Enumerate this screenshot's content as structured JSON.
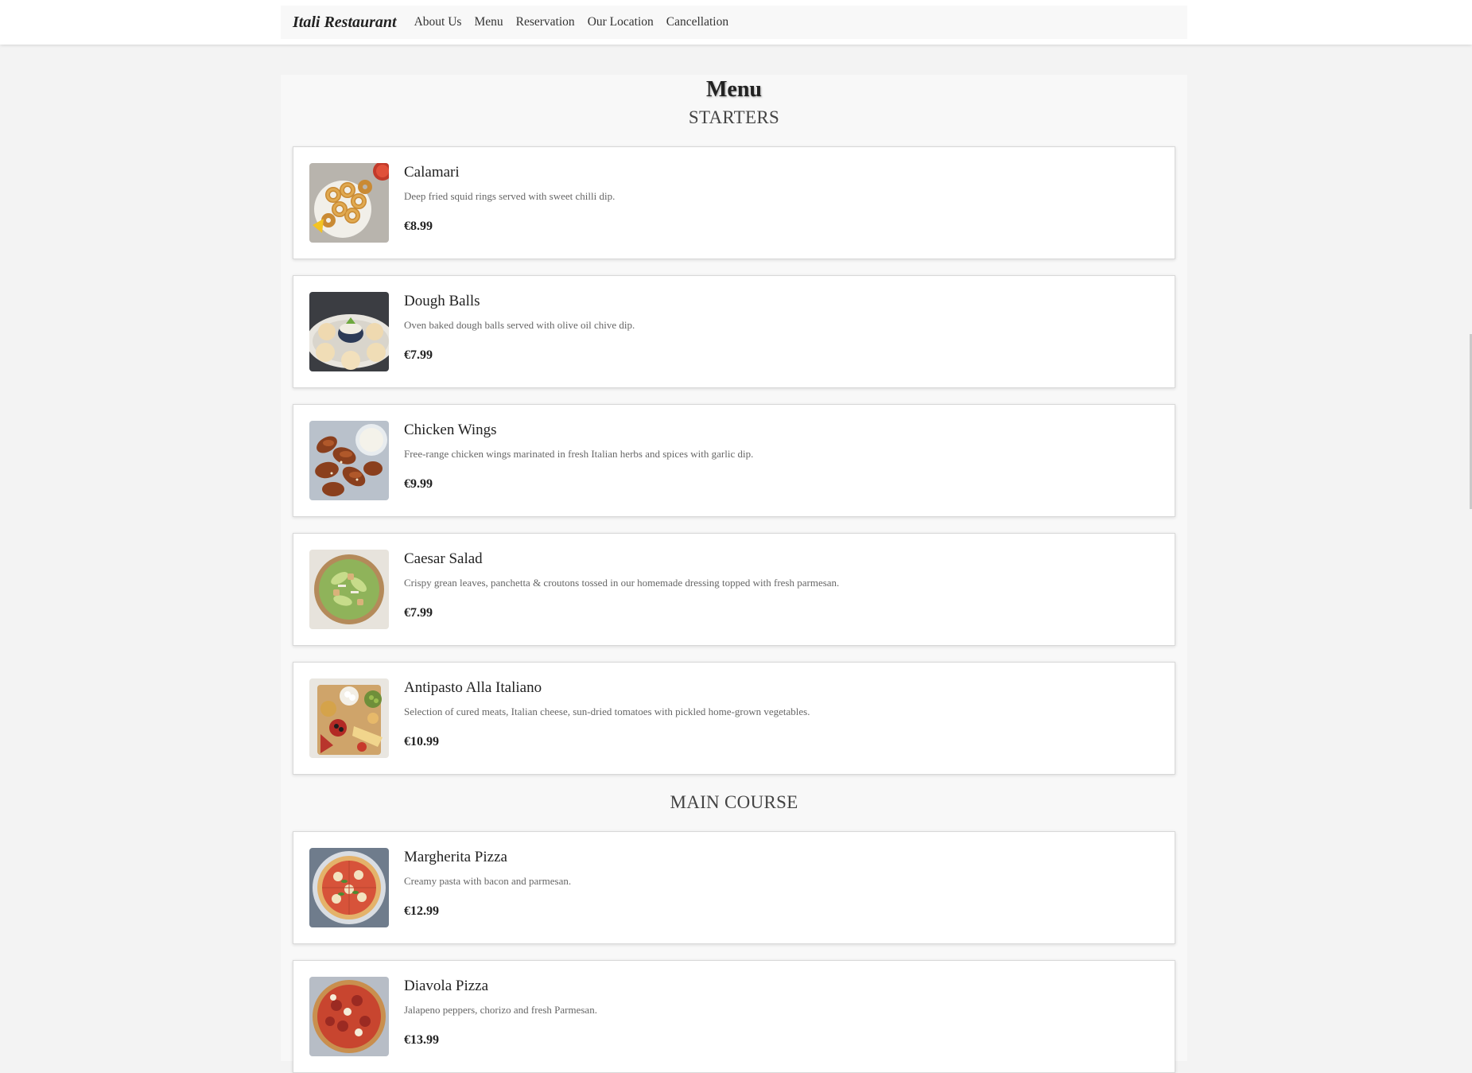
{
  "nav": {
    "brand": "Itali Restaurant",
    "links": [
      "About Us",
      "Menu",
      "Reservation",
      "Our Location",
      "Cancellation"
    ]
  },
  "page": {
    "title": "Menu"
  },
  "sections": [
    {
      "title": "STARTERS",
      "items": [
        {
          "name": "Calamari",
          "description": "Deep fried squid rings served with sweet chilli dip.",
          "price": "€8.99",
          "image": "calamari-photo"
        },
        {
          "name": "Dough Balls",
          "description": "Oven baked dough balls served with olive oil chive dip.",
          "price": "€7.99",
          "image": "dough-balls-photo"
        },
        {
          "name": "Chicken Wings",
          "description": "Free-range chicken wings marinated in fresh Italian herbs and spices with garlic dip.",
          "price": "€9.99",
          "image": "chicken-wings-photo"
        },
        {
          "name": "Caesar Salad",
          "description": "Crispy grean leaves, panchetta & croutons tossed in our homemade dressing topped with fresh parmesan.",
          "price": "€7.99",
          "image": "caesar-salad-photo"
        },
        {
          "name": "Antipasto Alla Italiano",
          "description": "Selection of cured meats, Italian cheese, sun-dried tomatoes with pickled home-grown vegetables.",
          "price": "€10.99",
          "image": "antipasto-photo"
        }
      ]
    },
    {
      "title": "MAIN COURSE",
      "items": [
        {
          "name": "Margherita Pizza",
          "description": "Creamy pasta with bacon and parmesan.",
          "price": "€12.99",
          "image": "margherita-pizza-photo"
        },
        {
          "name": "Diavola Pizza",
          "description": "Jalapeno peppers, chorizo and fresh Parmesan.",
          "price": "€13.99",
          "image": "diavola-pizza-photo"
        }
      ]
    }
  ]
}
